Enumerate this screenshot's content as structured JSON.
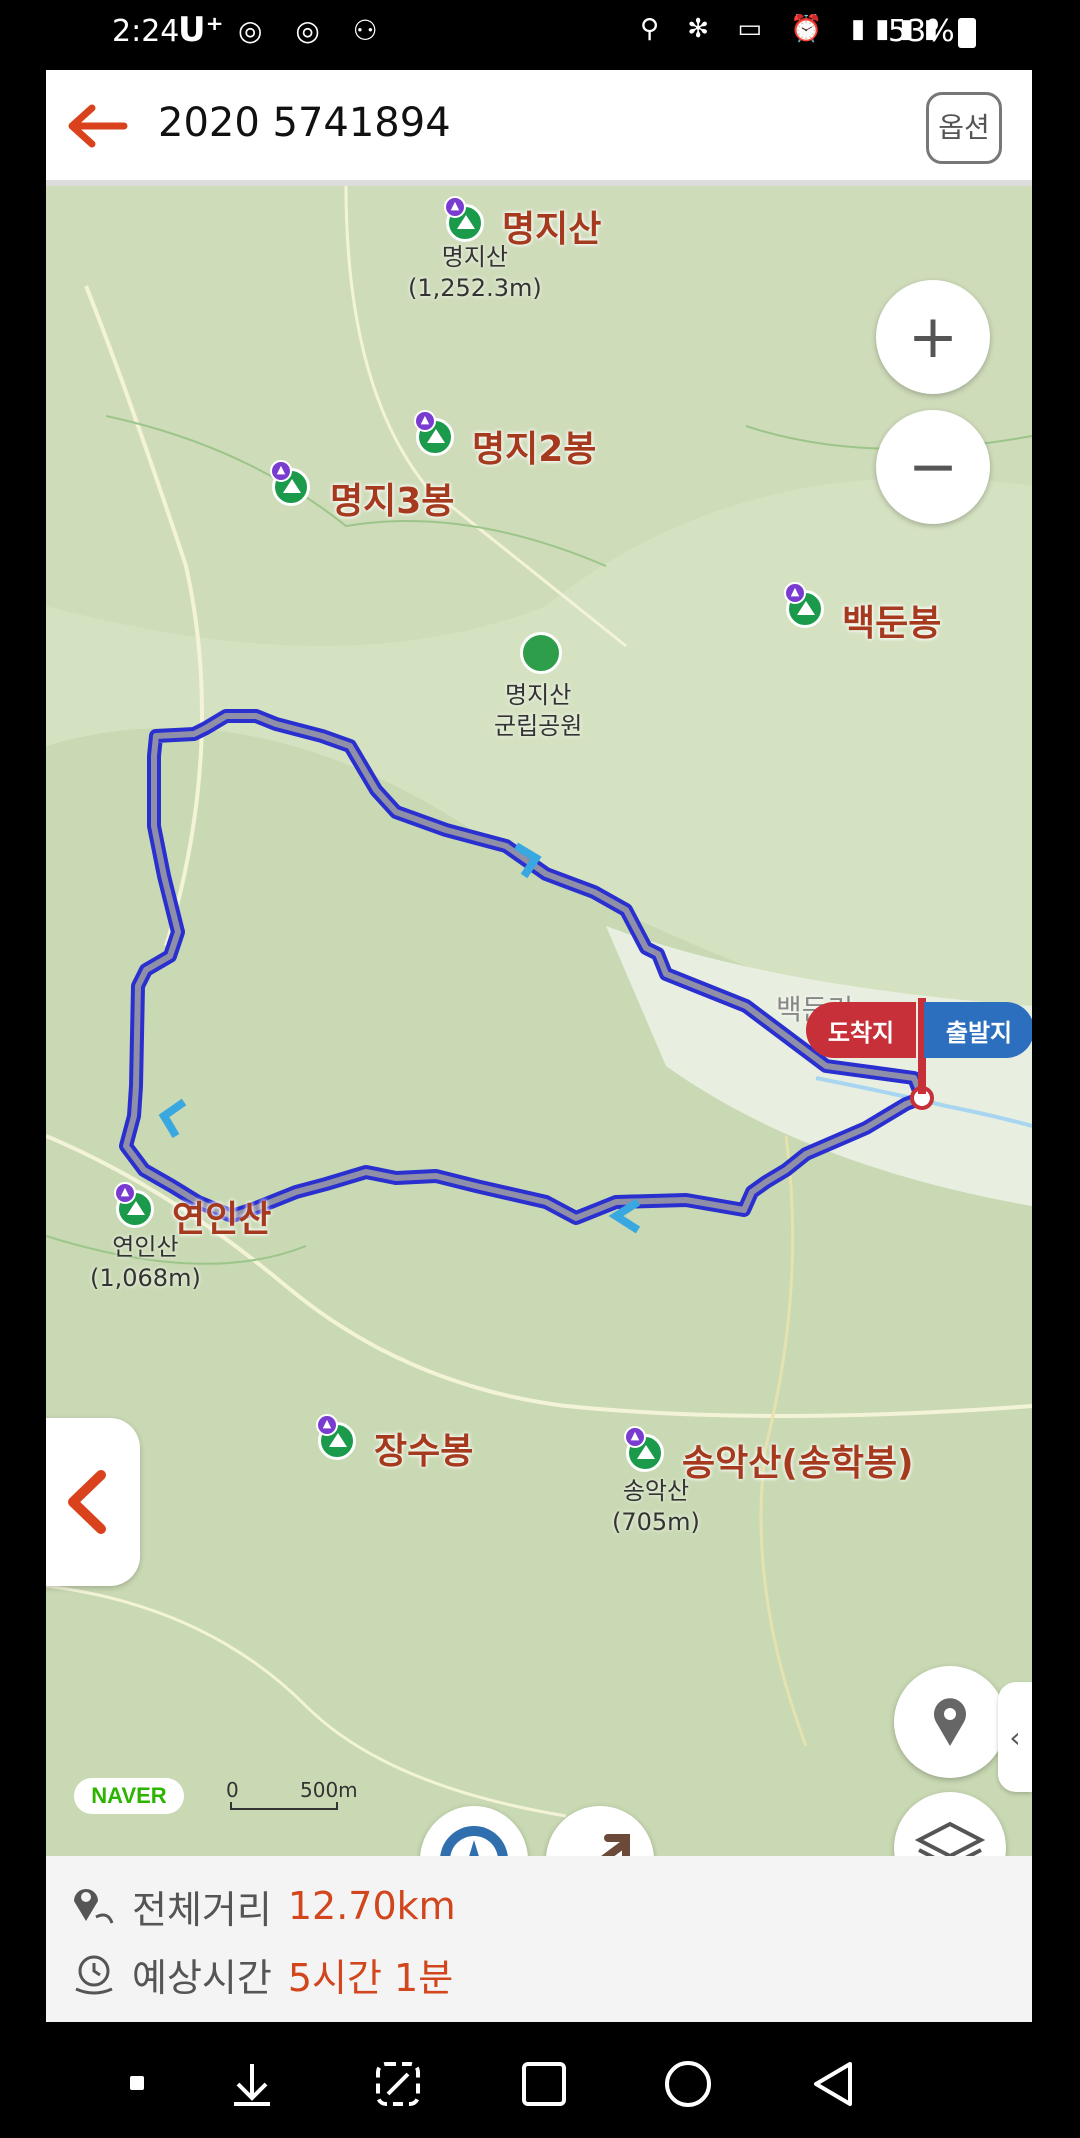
{
  "status": {
    "time": "2:24",
    "carrier": "U⁺",
    "left_icons": "◎ ◎ ⚇",
    "right_icons": "⚲ ✻ ▭ ⏰ ▮▮▮▮",
    "battery": "53%"
  },
  "header": {
    "title": "2020 5741894",
    "options_label": "옵션"
  },
  "map": {
    "peaks": [
      {
        "name": "명지산",
        "sub": "명지산\n(1,252.3m)"
      },
      {
        "name": "명지2봉"
      },
      {
        "name": "명지3봉"
      },
      {
        "name": "백둔봉"
      },
      {
        "name": "연인산",
        "sub": "연인산\n(1,068m)"
      },
      {
        "name": "장수봉"
      },
      {
        "name": "송악산(송학봉)",
        "sub": "송악산\n(705m)"
      }
    ],
    "park_label": "명지산\n군립공원",
    "village_label": "백둔리",
    "flag_arrive": "도착지",
    "flag_start": "출발지",
    "naver_logo": "NAVER",
    "scale_zero": "0",
    "scale_dist": "500m",
    "zoom_in": "+",
    "zoom_out": "−"
  },
  "info": {
    "distance_label": "전체거리",
    "distance_value": "12.70km",
    "time_label": "예상시간",
    "time_value": "5시간 1분"
  }
}
